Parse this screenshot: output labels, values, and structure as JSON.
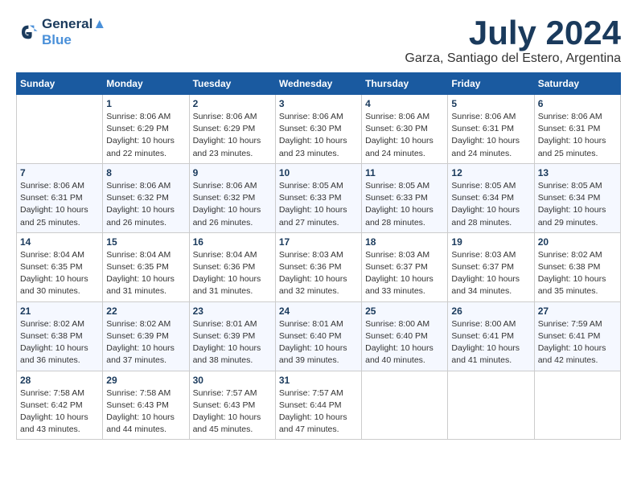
{
  "logo": {
    "line1": "General",
    "line2": "Blue"
  },
  "title": "July 2024",
  "subtitle": "Garza, Santiago del Estero, Argentina",
  "weekdays": [
    "Sunday",
    "Monday",
    "Tuesday",
    "Wednesday",
    "Thursday",
    "Friday",
    "Saturday"
  ],
  "weeks": [
    [
      {
        "day": "",
        "sunrise": "",
        "sunset": "",
        "daylight": ""
      },
      {
        "day": "1",
        "sunrise": "Sunrise: 8:06 AM",
        "sunset": "Sunset: 6:29 PM",
        "daylight": "Daylight: 10 hours and 22 minutes."
      },
      {
        "day": "2",
        "sunrise": "Sunrise: 8:06 AM",
        "sunset": "Sunset: 6:29 PM",
        "daylight": "Daylight: 10 hours and 23 minutes."
      },
      {
        "day": "3",
        "sunrise": "Sunrise: 8:06 AM",
        "sunset": "Sunset: 6:30 PM",
        "daylight": "Daylight: 10 hours and 23 minutes."
      },
      {
        "day": "4",
        "sunrise": "Sunrise: 8:06 AM",
        "sunset": "Sunset: 6:30 PM",
        "daylight": "Daylight: 10 hours and 24 minutes."
      },
      {
        "day": "5",
        "sunrise": "Sunrise: 8:06 AM",
        "sunset": "Sunset: 6:31 PM",
        "daylight": "Daylight: 10 hours and 24 minutes."
      },
      {
        "day": "6",
        "sunrise": "Sunrise: 8:06 AM",
        "sunset": "Sunset: 6:31 PM",
        "daylight": "Daylight: 10 hours and 25 minutes."
      }
    ],
    [
      {
        "day": "7",
        "sunrise": "Sunrise: 8:06 AM",
        "sunset": "Sunset: 6:31 PM",
        "daylight": "Daylight: 10 hours and 25 minutes."
      },
      {
        "day": "8",
        "sunrise": "Sunrise: 8:06 AM",
        "sunset": "Sunset: 6:32 PM",
        "daylight": "Daylight: 10 hours and 26 minutes."
      },
      {
        "day": "9",
        "sunrise": "Sunrise: 8:06 AM",
        "sunset": "Sunset: 6:32 PM",
        "daylight": "Daylight: 10 hours and 26 minutes."
      },
      {
        "day": "10",
        "sunrise": "Sunrise: 8:05 AM",
        "sunset": "Sunset: 6:33 PM",
        "daylight": "Daylight: 10 hours and 27 minutes."
      },
      {
        "day": "11",
        "sunrise": "Sunrise: 8:05 AM",
        "sunset": "Sunset: 6:33 PM",
        "daylight": "Daylight: 10 hours and 28 minutes."
      },
      {
        "day": "12",
        "sunrise": "Sunrise: 8:05 AM",
        "sunset": "Sunset: 6:34 PM",
        "daylight": "Daylight: 10 hours and 28 minutes."
      },
      {
        "day": "13",
        "sunrise": "Sunrise: 8:05 AM",
        "sunset": "Sunset: 6:34 PM",
        "daylight": "Daylight: 10 hours and 29 minutes."
      }
    ],
    [
      {
        "day": "14",
        "sunrise": "Sunrise: 8:04 AM",
        "sunset": "Sunset: 6:35 PM",
        "daylight": "Daylight: 10 hours and 30 minutes."
      },
      {
        "day": "15",
        "sunrise": "Sunrise: 8:04 AM",
        "sunset": "Sunset: 6:35 PM",
        "daylight": "Daylight: 10 hours and 31 minutes."
      },
      {
        "day": "16",
        "sunrise": "Sunrise: 8:04 AM",
        "sunset": "Sunset: 6:36 PM",
        "daylight": "Daylight: 10 hours and 31 minutes."
      },
      {
        "day": "17",
        "sunrise": "Sunrise: 8:03 AM",
        "sunset": "Sunset: 6:36 PM",
        "daylight": "Daylight: 10 hours and 32 minutes."
      },
      {
        "day": "18",
        "sunrise": "Sunrise: 8:03 AM",
        "sunset": "Sunset: 6:37 PM",
        "daylight": "Daylight: 10 hours and 33 minutes."
      },
      {
        "day": "19",
        "sunrise": "Sunrise: 8:03 AM",
        "sunset": "Sunset: 6:37 PM",
        "daylight": "Daylight: 10 hours and 34 minutes."
      },
      {
        "day": "20",
        "sunrise": "Sunrise: 8:02 AM",
        "sunset": "Sunset: 6:38 PM",
        "daylight": "Daylight: 10 hours and 35 minutes."
      }
    ],
    [
      {
        "day": "21",
        "sunrise": "Sunrise: 8:02 AM",
        "sunset": "Sunset: 6:38 PM",
        "daylight": "Daylight: 10 hours and 36 minutes."
      },
      {
        "day": "22",
        "sunrise": "Sunrise: 8:02 AM",
        "sunset": "Sunset: 6:39 PM",
        "daylight": "Daylight: 10 hours and 37 minutes."
      },
      {
        "day": "23",
        "sunrise": "Sunrise: 8:01 AM",
        "sunset": "Sunset: 6:39 PM",
        "daylight": "Daylight: 10 hours and 38 minutes."
      },
      {
        "day": "24",
        "sunrise": "Sunrise: 8:01 AM",
        "sunset": "Sunset: 6:40 PM",
        "daylight": "Daylight: 10 hours and 39 minutes."
      },
      {
        "day": "25",
        "sunrise": "Sunrise: 8:00 AM",
        "sunset": "Sunset: 6:40 PM",
        "daylight": "Daylight: 10 hours and 40 minutes."
      },
      {
        "day": "26",
        "sunrise": "Sunrise: 8:00 AM",
        "sunset": "Sunset: 6:41 PM",
        "daylight": "Daylight: 10 hours and 41 minutes."
      },
      {
        "day": "27",
        "sunrise": "Sunrise: 7:59 AM",
        "sunset": "Sunset: 6:41 PM",
        "daylight": "Daylight: 10 hours and 42 minutes."
      }
    ],
    [
      {
        "day": "28",
        "sunrise": "Sunrise: 7:58 AM",
        "sunset": "Sunset: 6:42 PM",
        "daylight": "Daylight: 10 hours and 43 minutes."
      },
      {
        "day": "29",
        "sunrise": "Sunrise: 7:58 AM",
        "sunset": "Sunset: 6:43 PM",
        "daylight": "Daylight: 10 hours and 44 minutes."
      },
      {
        "day": "30",
        "sunrise": "Sunrise: 7:57 AM",
        "sunset": "Sunset: 6:43 PM",
        "daylight": "Daylight: 10 hours and 45 minutes."
      },
      {
        "day": "31",
        "sunrise": "Sunrise: 7:57 AM",
        "sunset": "Sunset: 6:44 PM",
        "daylight": "Daylight: 10 hours and 47 minutes."
      },
      {
        "day": "",
        "sunrise": "",
        "sunset": "",
        "daylight": ""
      },
      {
        "day": "",
        "sunrise": "",
        "sunset": "",
        "daylight": ""
      },
      {
        "day": "",
        "sunrise": "",
        "sunset": "",
        "daylight": ""
      }
    ]
  ]
}
